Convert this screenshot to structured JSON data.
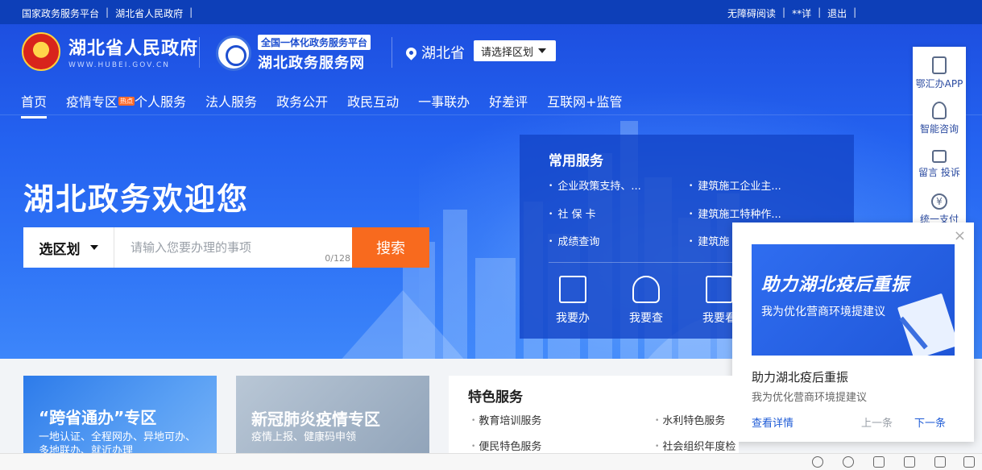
{
  "topbar": {
    "left_links": [
      "国家政务服务平台",
      "湖北省人民政府"
    ],
    "right_links": [
      "无障碍阅读",
      "**详",
      "退出"
    ]
  },
  "header": {
    "gov_name": "湖北省人民政府",
    "gov_domain": "WWW.HUBEI.GOV.CN",
    "platform_tag": "全国一体化政务服务平台",
    "platform_name": "湖北政务服务网",
    "location": "湖北省",
    "region_select": "请选择区划"
  },
  "nav": {
    "items": [
      {
        "label": "首页",
        "active": true
      },
      {
        "label": "疫情专区",
        "badge": "热点"
      },
      {
        "label": "个人服务"
      },
      {
        "label": "法人服务"
      },
      {
        "label": "政务公开"
      },
      {
        "label": "政民互动"
      },
      {
        "label": "一事联办"
      },
      {
        "label": "好差评"
      },
      {
        "label": "互联网+监管"
      }
    ]
  },
  "hero": {
    "welcome": "湖北政务欢迎您",
    "search": {
      "region_label": "选区划",
      "placeholder": "请输入您要办理的事项",
      "count": "0/128",
      "button": "搜索"
    }
  },
  "common_services": {
    "title": "常用服务",
    "links": [
      "企业政策支持、...",
      "建筑施工企业主...",
      "社 保 卡",
      "建筑施工特种作...",
      "成绩查询",
      "建筑施"
    ],
    "actions": [
      "我要办",
      "我要查",
      "我要看"
    ]
  },
  "right_toolbar": {
    "items": [
      "鄂汇办APP",
      "智能咨询",
      "留言 投诉",
      "统一支付"
    ]
  },
  "popup": {
    "banner_title": "助力湖北疫后重振",
    "banner_subtitle": "我为优化营商环境提建议",
    "title": "助力湖北疫后重振",
    "subtitle": "我为优化营商环境提建议",
    "more": "查看详情",
    "prev": "上一条",
    "next": "下一条",
    "close": "×"
  },
  "cards": [
    {
      "title": "“跨省通办”专区",
      "subtitle": "一地认证、全程网办、异地可办、多地联办、就近办理"
    },
    {
      "title": "新冠肺炎疫情专区",
      "subtitle": "疫情上报、健康码申领"
    }
  ],
  "featured": {
    "title": "特色服务",
    "items": [
      "教育培训服务",
      "水利特色服务",
      "便民特色服务",
      "社会组织年度检查"
    ]
  },
  "colors": {
    "topbar": "#0d3fb8",
    "hero": "#2462f0",
    "search_button": "#f86a1e",
    "link": "#1e5bd6"
  }
}
